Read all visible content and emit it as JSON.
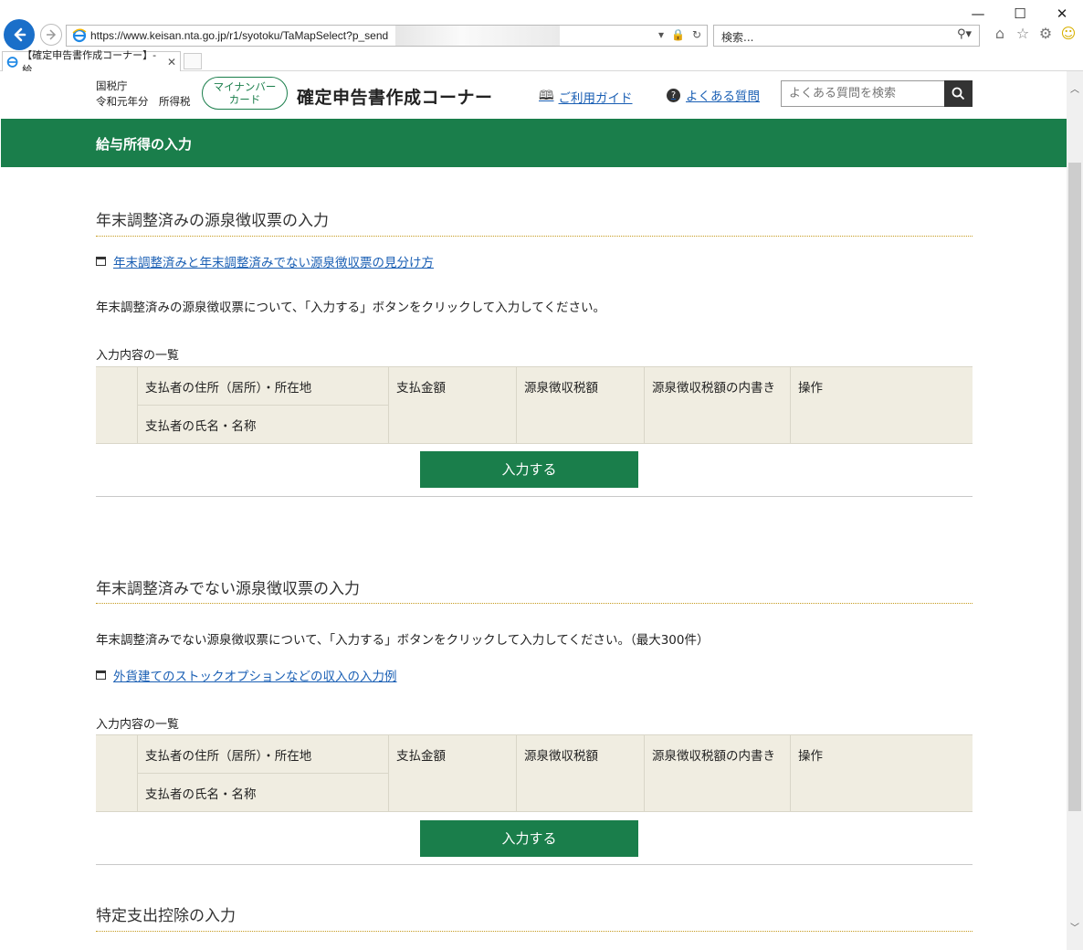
{
  "browser": {
    "url": "https://www.keisan.nta.go.jp/r1/syotoku/TaMapSelect?p_send",
    "search_placeholder": "検索...",
    "tab_title": "【確定申告書作成コーナー】-給...",
    "tab_close": "✕",
    "win_minimize": "—",
    "win_maximize": "☐",
    "win_close": "✕"
  },
  "header": {
    "agency_line1": "国税庁",
    "agency_line2": "令和元年分　所得税",
    "mynumber_line1": "マイナンバー",
    "mynumber_line2": "カード",
    "site_title": "確定申告書作成コーナー",
    "guide_link": "ご利用ガイド",
    "faq_link": "よくある質問",
    "faq_search_placeholder": "よくある質問を検索"
  },
  "page_title": "給与所得の入力",
  "section1": {
    "title": "年末調整済みの源泉徴収票の入力",
    "link": "年末調整済みと年末調整済みでない源泉徴収票の見分け方",
    "description": "年末調整済みの源泉徴収票について、「入力する」ボタンをクリックして入力してください。",
    "list_label": "入力内容の一覧",
    "button": "入力する"
  },
  "section2": {
    "title": "年末調整済みでない源泉徴収票の入力",
    "description": "年末調整済みでない源泉徴収票について、「入力する」ボタンをクリックして入力してください。（最大300件）",
    "link": "外貨建てのストックオプションなどの収入の入力例",
    "list_label": "入力内容の一覧",
    "button": "入力する"
  },
  "section3": {
    "title": "特定支出控除の入力"
  },
  "table_headers": {
    "payer_address": "支払者の住所（居所）・所在地",
    "payer_name": "支払者の氏名・名称",
    "amount": "支払金額",
    "withholding": "源泉徴収税額",
    "withholding_breakdown": "源泉徴収税額の内書き",
    "action": "操作"
  }
}
